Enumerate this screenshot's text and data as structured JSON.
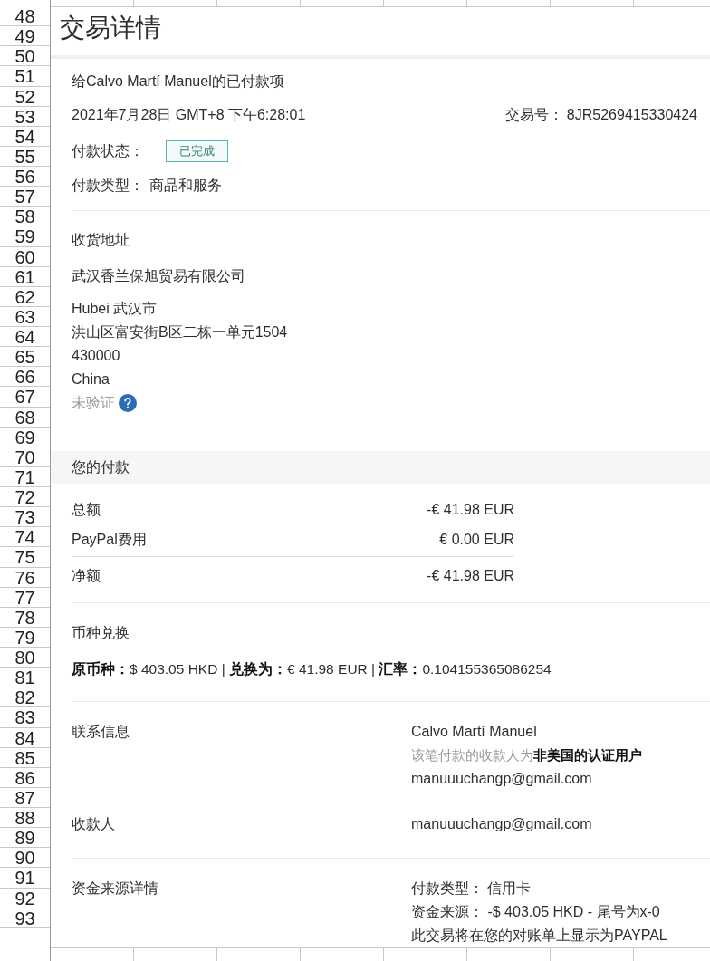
{
  "spreadsheet": {
    "row_numbers": [
      "48",
      "49",
      "50",
      "51",
      "52",
      "53",
      "54",
      "55",
      "56",
      "57",
      "58",
      "59",
      "60",
      "61",
      "62",
      "63",
      "64",
      "65",
      "66",
      "67",
      "68",
      "69",
      "70",
      "71",
      "72",
      "73",
      "74",
      "75",
      "76",
      "77",
      "78",
      "79",
      "80",
      "81",
      "82",
      "83",
      "84",
      "85",
      "86",
      "87",
      "88",
      "89",
      "90",
      "91",
      "92",
      "93"
    ]
  },
  "page": {
    "title": "交易详情",
    "summary": {
      "heading": "给Calvo Martí Manuel的已付款项",
      "date": "2021年7月28日 GMT+8 下午6:28:01",
      "transaction_label": "交易号：",
      "transaction_id": "8JR5269415330424",
      "status_label": "付款状态：",
      "status": "已完成",
      "type_label": "付款类型：",
      "type": "商品和服务"
    },
    "shipping": {
      "heading": "收货地址",
      "company": "武汉香兰保旭贸易有限公司",
      "lines": [
        "Hubei 武汉市",
        "洪山区富安街B区二栋一单元1504",
        "430000",
        "China"
      ],
      "verification": "未验证"
    },
    "payment": {
      "heading": "您的付款",
      "rows": [
        {
          "kind": "item",
          "label": "总额",
          "amount": "-€ 41.98 EUR"
        },
        {
          "kind": "item",
          "label": "PayPal费用",
          "amount": "€ 0.00 EUR"
        },
        {
          "kind": "total",
          "label": "净额",
          "amount": "-€ 41.98 EUR"
        }
      ]
    },
    "conversion": {
      "heading": "币种兑换",
      "text": "**原币种：**$ 403.05 HKD | **兑换为：**€ 41.98 EUR | **汇率：**0.104155365086254"
    },
    "details": [
      {
        "label": "联系信息",
        "divider": false,
        "lines": [
          {
            "kind": "text",
            "text": "Calvo Martí Manuel"
          },
          {
            "kind": "note",
            "text": "该笔付款的收款人为**非美国的认证用户**"
          },
          {
            "kind": "text",
            "text": "manuuuchangp@gmail.com"
          }
        ]
      },
      {
        "label": "收款人",
        "divider": false,
        "lines": [
          {
            "kind": "text",
            "text": "manuuuchangp@gmail.com"
          }
        ]
      },
      {
        "label": "资金来源详情",
        "divider": true,
        "lines": [
          {
            "kind": "text",
            "text": "付款类型： 信用卡"
          },
          {
            "kind": "text",
            "text": "资金来源： -$ 403.05 HKD - 尾号为x-0"
          },
          {
            "kind": "text",
            "text": "此交易将在您的对账单上显示为PAYPAL"
          }
        ]
      }
    ]
  }
}
